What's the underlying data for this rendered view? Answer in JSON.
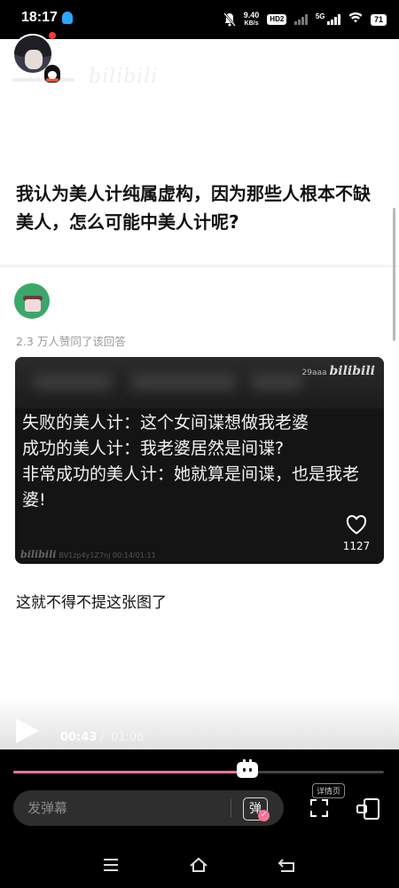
{
  "status_bar": {
    "time": "18:17",
    "net_speed_value": "9.40",
    "net_speed_unit": "KB/s",
    "hd_label": "HD2",
    "network_type": "5G",
    "battery": "71"
  },
  "header": {
    "watermark": "bilibili"
  },
  "question": {
    "title": "我认为美人计纯属虚构，因为那些人根本不缺美人，怎么可能中美人计呢?"
  },
  "answer": {
    "likes_text": "2.3 万人赞同了该回答",
    "image": {
      "watermark_top_id": "29aaa",
      "watermark_top_logo": "bilibili",
      "text": "失败的美人计：这个女间谍想做我老婆\n成功的美人计：我老婆居然是间谍?\n非常成功的美人计：她就算是间谍，也是我老婆!",
      "like_count": "1127",
      "watermark_bottom_logo": "bilibili",
      "watermark_bottom_text": "BV1zp4y1Z7nj 00:14/01:11"
    },
    "caption": "这就不得不提这张图了"
  },
  "player": {
    "current_time": "00:43",
    "separator": "/",
    "total_time": "01:08",
    "progress_fraction": 0.632,
    "danmaku_placeholder": "发弹幕",
    "danmaku_toggle_label": "弹",
    "detail_tag": "详情页",
    "accent_color": "#fb7299"
  },
  "icons": {
    "qq_status": "qq-icon",
    "mute": "bell-off-icon",
    "wifi": "wifi-icon",
    "heart": "heart-icon",
    "fullscreen": "fullscreen-icon",
    "pip": "picture-in-picture-icon",
    "nav_menu": "menu-icon",
    "nav_home": "home-icon",
    "nav_back": "back-icon"
  }
}
